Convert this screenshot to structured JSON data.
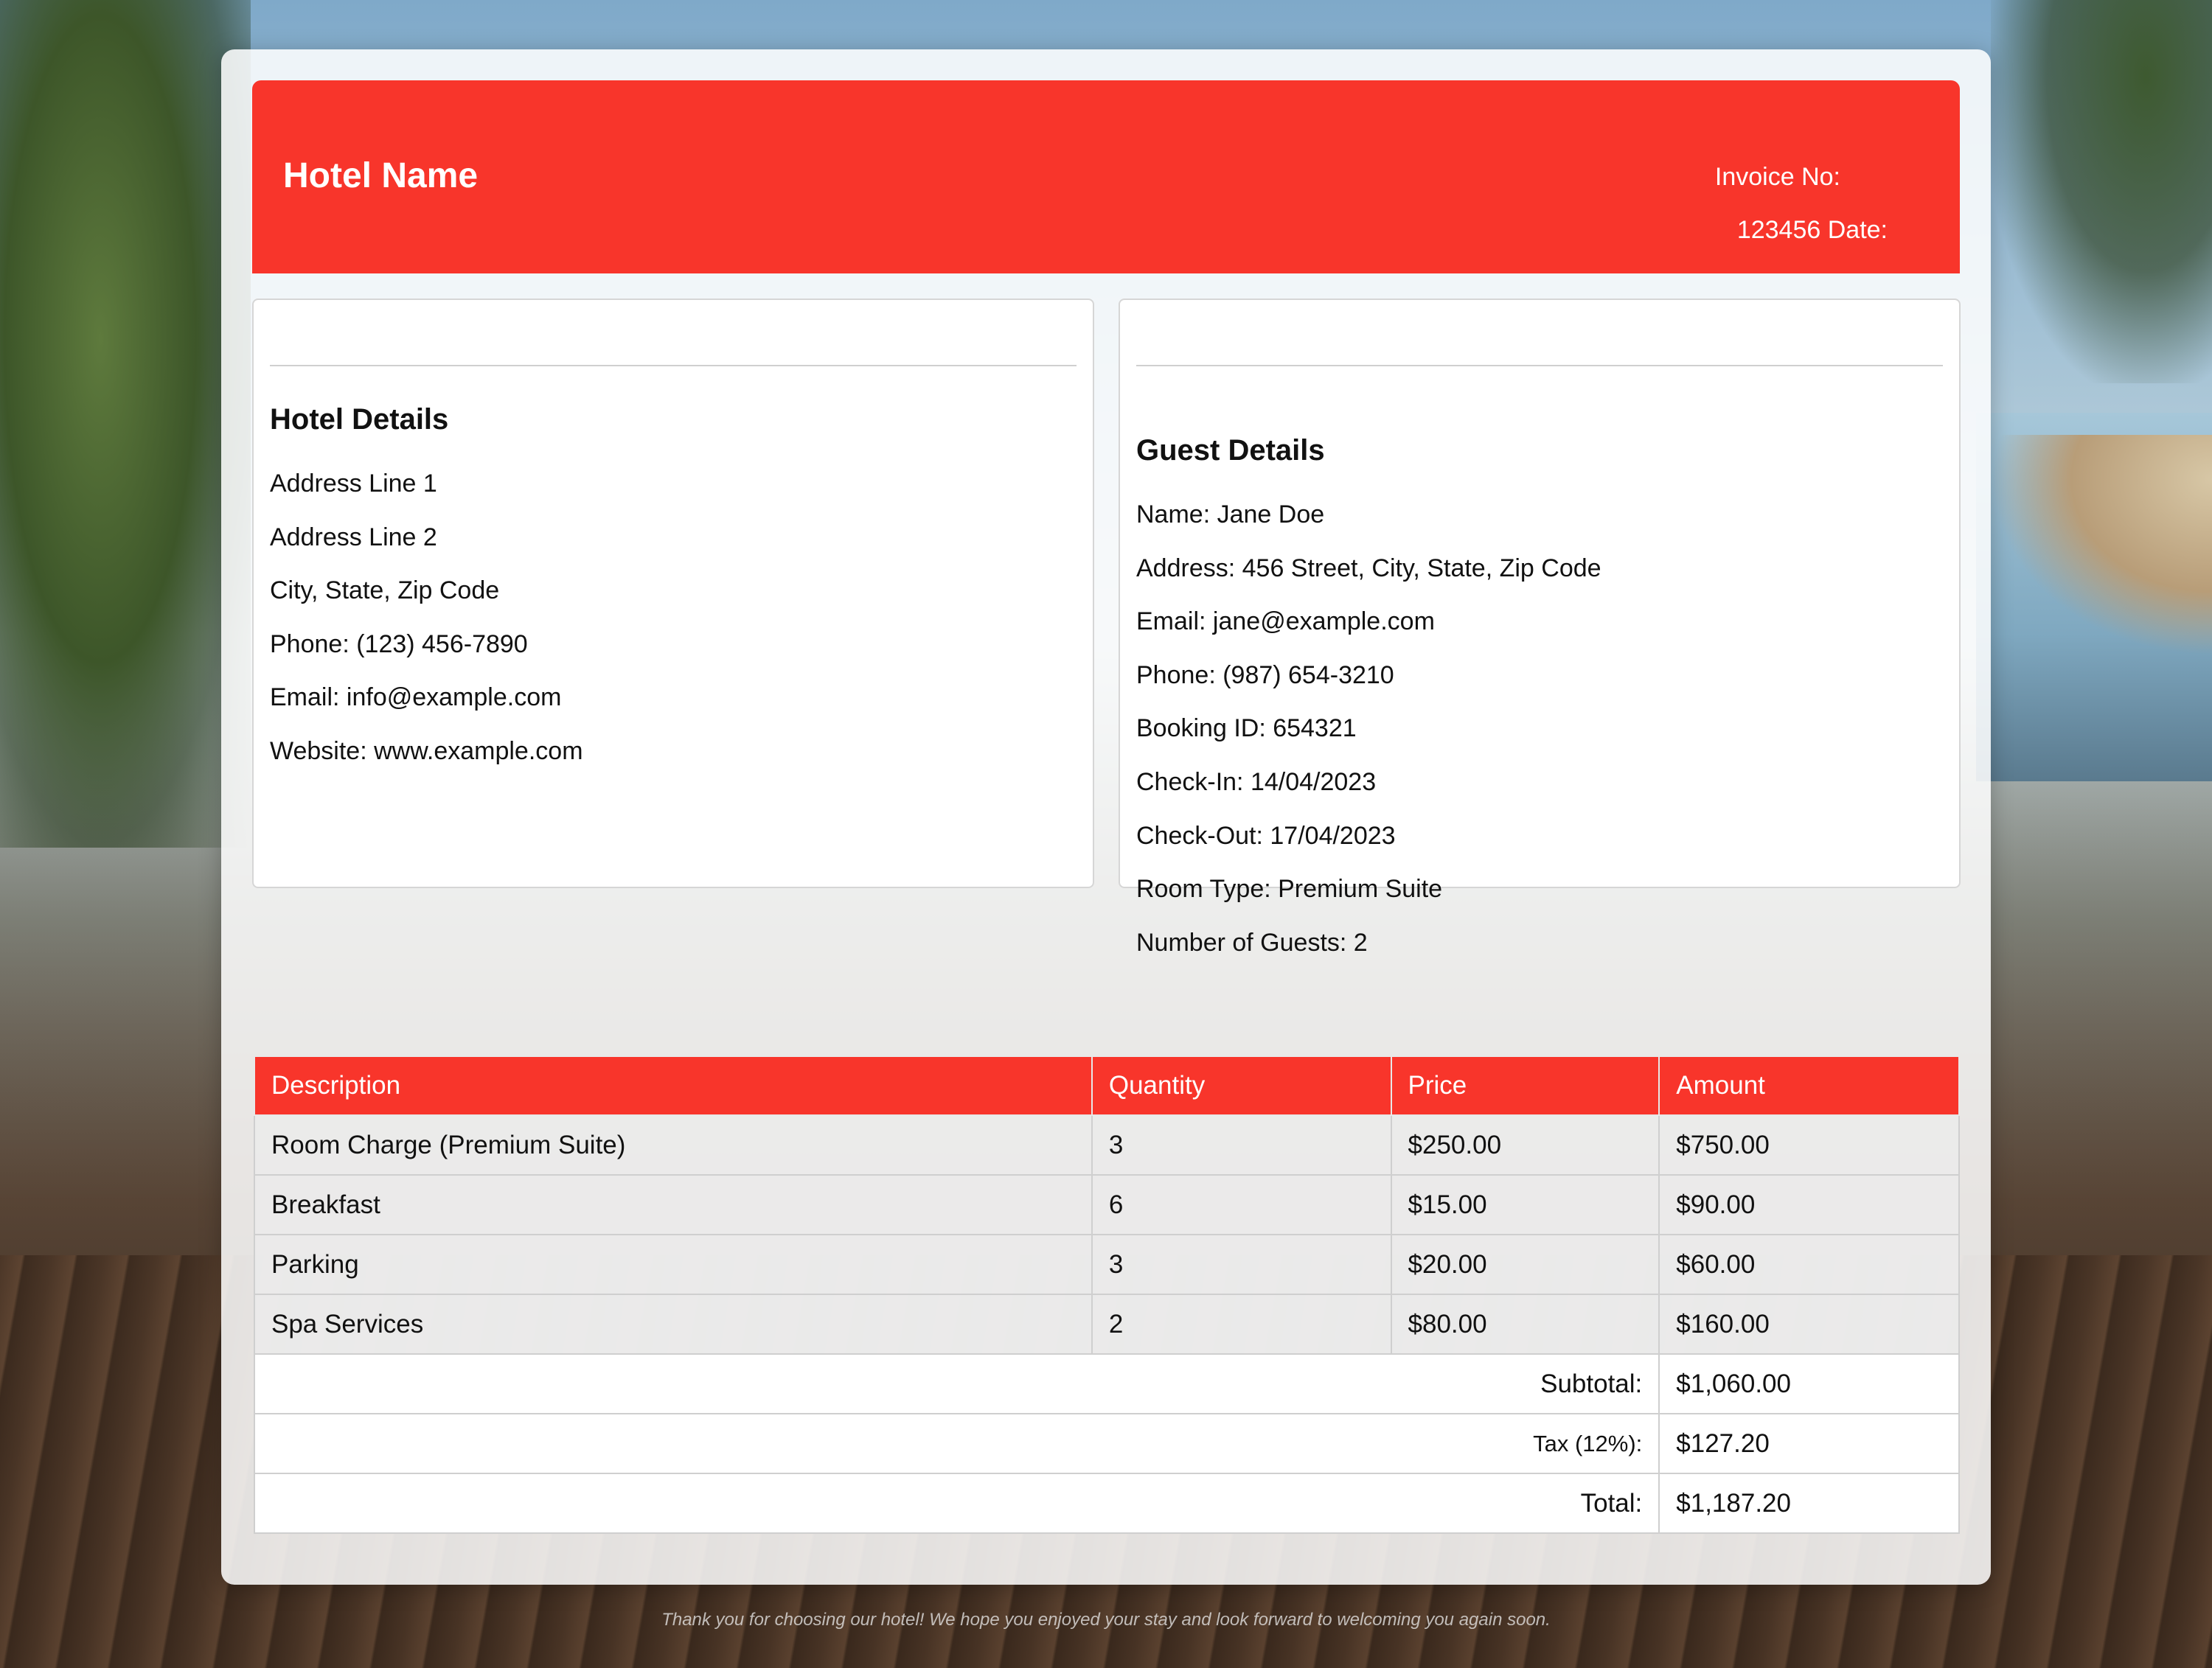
{
  "header": {
    "hotel_name": "Hotel Name",
    "invoice_line1": "Invoice No:",
    "invoice_line2": "123456 Date:"
  },
  "hotel_details": {
    "heading": "Hotel Details",
    "lines": [
      "Address Line 1",
      "Address Line 2",
      "City, State, Zip Code",
      "Phone: (123) 456-7890",
      "Email: info@example.com",
      "Website: www.example.com"
    ]
  },
  "guest_details": {
    "heading": "Guest Details",
    "lines": [
      "Name: Jane Doe",
      "Address: 456 Street, City, State, Zip Code",
      "Email: jane@example.com",
      "Phone: (987) 654-3210",
      "Booking ID: 654321",
      "Check-In: 14/04/2023",
      "Check-Out: 17/04/2023",
      "Room Type: Premium Suite",
      "Number of Guests: 2"
    ]
  },
  "table": {
    "headers": [
      "Description",
      "Quantity",
      "Price",
      "Amount"
    ],
    "rows": [
      [
        "Room Charge (Premium Suite)",
        "3",
        "$250.00",
        "$750.00"
      ],
      [
        "Breakfast",
        "6",
        "$15.00",
        "$90.00"
      ],
      [
        "Parking",
        "3",
        "$20.00",
        "$60.00"
      ],
      [
        "Spa Services",
        "2",
        "$80.00",
        "$160.00"
      ]
    ],
    "subtotal_label": "Subtotal:",
    "subtotal_value": "$1,060.00",
    "tax_label": "Tax (12%):",
    "tax_value": "$127.20",
    "total_label": "Total:",
    "total_value": "$1,187.20"
  },
  "footer_note": "Thank you for choosing our hotel! We hope you enjoyed your stay and look forward to welcoming you again soon."
}
